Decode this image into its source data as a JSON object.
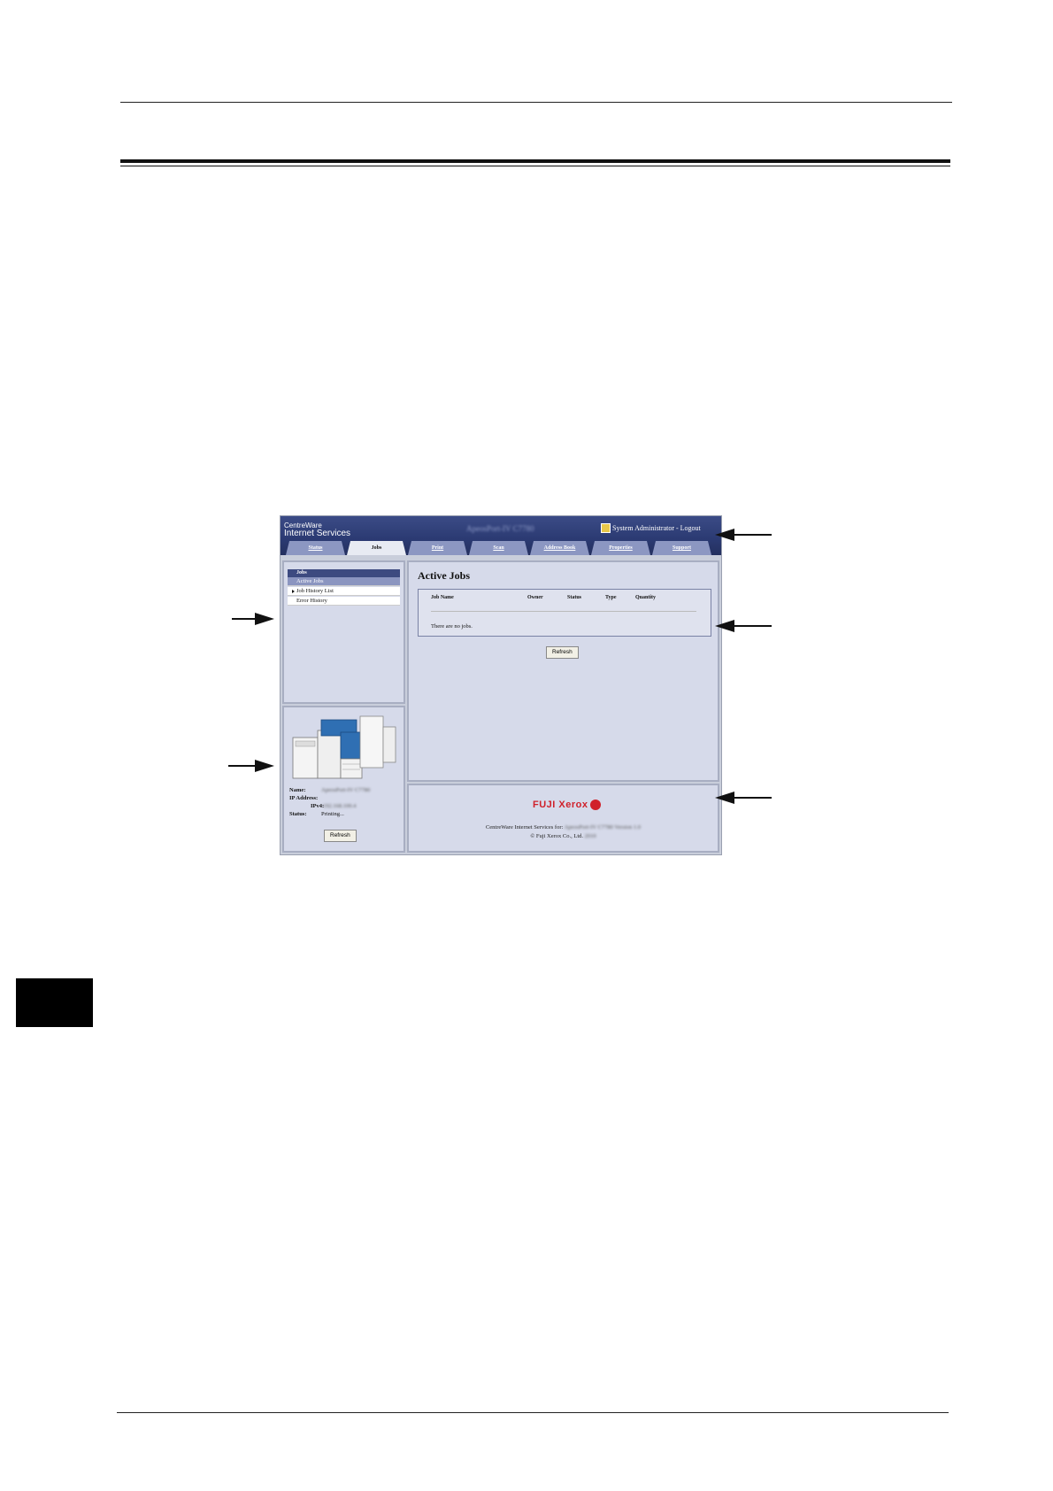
{
  "header": {
    "brand_line1": "CentreWare",
    "brand_line2": "Internet Services",
    "model": "ApeosPort-IV C7780",
    "user": "System Administrator - Logout"
  },
  "tabs": [
    {
      "label": "Status"
    },
    {
      "label": "Jobs"
    },
    {
      "label": "Print"
    },
    {
      "label": "Scan"
    },
    {
      "label": "Address Book"
    },
    {
      "label": "Properties"
    },
    {
      "label": "Support"
    }
  ],
  "nav": {
    "heading": "Jobs",
    "items": [
      {
        "label": "Active Jobs"
      },
      {
        "label": "Job History List"
      },
      {
        "label": "Error History"
      }
    ]
  },
  "device": {
    "name_label": "Name:",
    "name_value": "ApeosPort-IV C7780",
    "ip_label": "IP Address:",
    "ipv4_label": "IPv4:",
    "ipv4_value": "192.168.100.4",
    "status_label": "Status:",
    "status_value": "Printing...",
    "refresh": "Refresh"
  },
  "main": {
    "title": "Active Jobs",
    "columns": [
      "Job Name",
      "Owner",
      "Status",
      "Type",
      "Quantity"
    ],
    "empty": "There are no jobs.",
    "refresh": "Refresh"
  },
  "footer": {
    "logo": "FUJI Xerox",
    "line1_prefix": "CentreWare Internet Services for:",
    "line1_blur": "ApeosPort-IV C7780 Version 1.0",
    "line2_prefix": "© Fuji Xerox Co., Ltd.",
    "line2_blur": "2010"
  },
  "colors": {
    "header": "#2b3a72",
    "panel": "#d6daea",
    "active_nav": "#8b95c0",
    "brand_red": "#d0202a"
  }
}
